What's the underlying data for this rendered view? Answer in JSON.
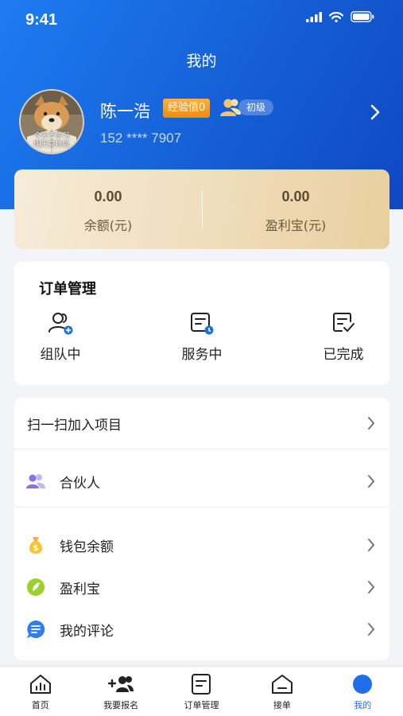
{
  "status_bar": {
    "time": "9:41"
  },
  "header": {
    "title": "我的"
  },
  "profile": {
    "name": "陈一浩",
    "exp_badge": "经验值0",
    "level": "初级",
    "phone": "152 **** 7907",
    "avatar_caption_1": "今天不学习",
    "avatar_caption_2": "明天变垃圾"
  },
  "balance": {
    "items": [
      {
        "value": "0.00",
        "label": "余额(元)"
      },
      {
        "value": "0.00",
        "label": "盈利宝(元)"
      }
    ]
  },
  "orders": {
    "title": "订单管理",
    "items": [
      {
        "label": "组队中",
        "icon": "team-icon"
      },
      {
        "label": "服务中",
        "icon": "in-service-icon"
      },
      {
        "label": "已完成",
        "icon": "completed-icon"
      }
    ]
  },
  "menu": {
    "items": [
      {
        "label": "扫一扫加入项目",
        "icon": ""
      },
      {
        "label": "合伙人",
        "icon": "partner-icon"
      },
      {
        "label": "钱包余额",
        "icon": "money-bag-icon"
      },
      {
        "label": "盈利宝",
        "icon": "leaf-icon"
      },
      {
        "label": "我的评论",
        "icon": "comment-icon"
      }
    ]
  },
  "tabbar": {
    "active_color": "#1e6fe8",
    "items": [
      {
        "label": "首页",
        "icon": "home-chart-icon"
      },
      {
        "label": "我要报名",
        "icon": "add-user-icon"
      },
      {
        "label": "订单管理",
        "icon": "order-icon"
      },
      {
        "label": "接单",
        "icon": "accept-order-icon"
      },
      {
        "label": "我的",
        "icon": "profile-icon",
        "active": true
      }
    ]
  }
}
